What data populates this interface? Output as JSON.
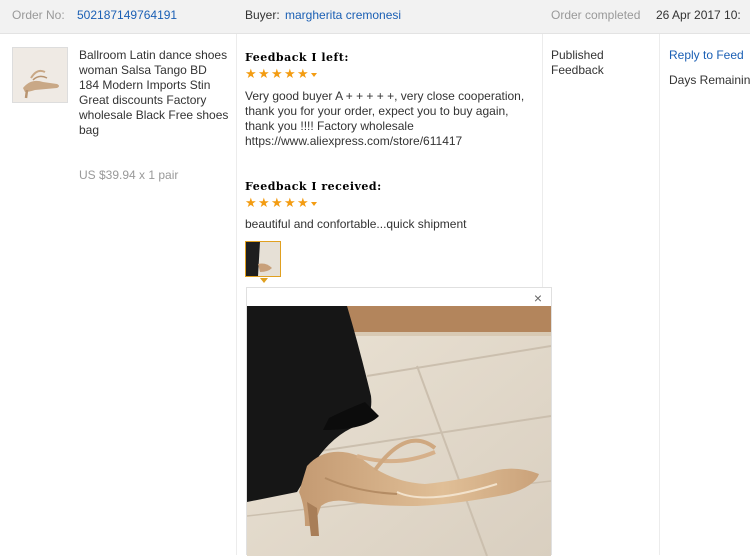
{
  "order": {
    "number_label": "Order No:",
    "number": "502187149764191",
    "buyer_label": "Buyer:",
    "buyer_name": "margherita cremonesi",
    "status_label": "Order completed",
    "date": "26 Apr 2017 10:"
  },
  "product": {
    "title": "Ballroom Latin dance shoes woman Salsa Tango BD 184 Modern Imports Stin Great discounts Factory wholesale Black Free shoes bag",
    "price": "US $39.94 x 1 pair"
  },
  "feedback_left": {
    "heading": "Feedback I left:",
    "stars": 5,
    "text": "Very good buyer A + + + + +, very close cooperation, thank you for your order, expect you to buy again, thank you !!!! Factory wholesale https://www.aliexpress.com/store/611417"
  },
  "feedback_received": {
    "heading": "Feedback I received:",
    "stars": 5,
    "text": "beautiful and confortable...quick shipment"
  },
  "status": {
    "line1": "Published",
    "line2": "Feedback"
  },
  "actions": {
    "reply_label": "Reply to Feed",
    "days_remaining": "Days Remainin"
  },
  "popup": {
    "close_glyph": "×"
  },
  "colors": {
    "link": "#1a5fb4",
    "star": "#f39c12",
    "header_bg": "#f2f2f2"
  },
  "icons": [
    "product-thumbnail",
    "star-icon",
    "close-icon",
    "buyer-photo"
  ]
}
